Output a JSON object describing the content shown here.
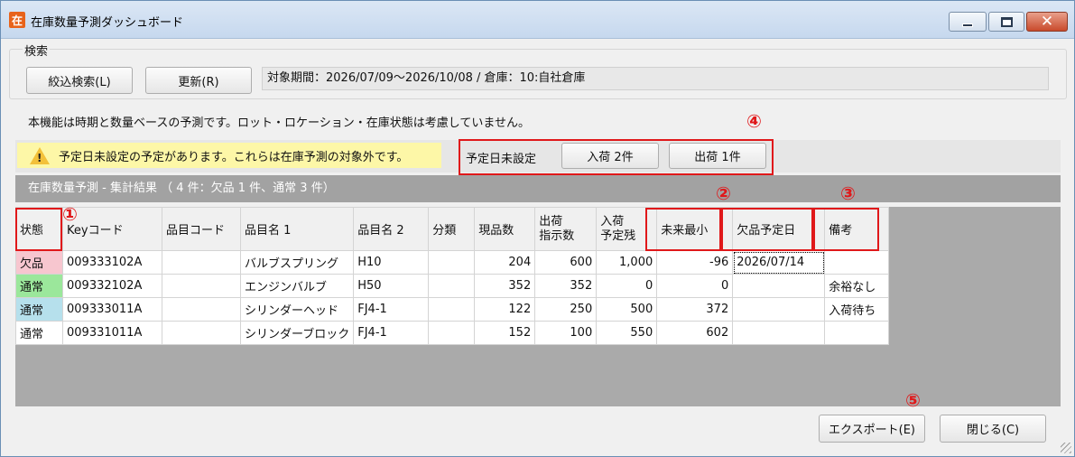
{
  "window": {
    "app_icon": "在",
    "title": "在庫数量予測ダッシュボード"
  },
  "search": {
    "group_label": "検索",
    "filter_button": "絞込検索(L)",
    "refresh_button": "更新(R)",
    "period_text": "対象期間：2026/07/09～2026/10/08 / 倉庫：10:自社倉庫"
  },
  "note": "本機能は時期と数量ベースの予測です。ロット・ロケーション・在庫状態は考慮していません。",
  "warning": {
    "icon": "warning-triangle-icon",
    "message": "予定日未設定の予定があります。これらは在庫予測の対象外です。",
    "unset_label": "予定日未設定",
    "incoming_button": "入荷 2件",
    "outgoing_button": "出荷 1件"
  },
  "summary": "在庫数量予測 - 集計結果 （ 4 件：欠品 1 件、通常 3 件）",
  "table": {
    "headers": [
      "状態",
      "Keyコード",
      "品目コード",
      "品目名 1",
      "品目名 2",
      "分類",
      "現品数",
      "出荷\n指示数",
      "入荷\n予定残",
      "未来最小",
      "欠品予定日",
      "備考"
    ],
    "rows": [
      {
        "status": "欠品",
        "key": "009333102A",
        "item_code": "",
        "name1": "バルブスプリング",
        "name2": "H10",
        "category": "",
        "stock": "204",
        "ship": "600",
        "incoming": "1,000",
        "future_min": "-96",
        "shortage_date": "2026/07/14",
        "remarks": ""
      },
      {
        "status": "通常",
        "key": "009332102A",
        "item_code": "",
        "name1": "エンジンバルブ",
        "name2": "H50",
        "category": "",
        "stock": "352",
        "ship": "352",
        "incoming": "0",
        "future_min": "0",
        "shortage_date": "",
        "remarks": "余裕なし"
      },
      {
        "status": "通常",
        "key": "009333011A",
        "item_code": "",
        "name1": "シリンダーヘッド",
        "name2": "FJ4-1",
        "category": "",
        "stock": "122",
        "ship": "250",
        "incoming": "500",
        "future_min": "372",
        "shortage_date": "",
        "remarks": "入荷待ち"
      },
      {
        "status": "通常",
        "key": "009331011A",
        "item_code": "",
        "name1": "シリンダーブロック",
        "name2": "FJ4-1",
        "category": "",
        "stock": "152",
        "ship": "100",
        "incoming": "550",
        "future_min": "602",
        "shortage_date": "",
        "remarks": ""
      }
    ]
  },
  "annotations": [
    "①",
    "②",
    "③",
    "④",
    "⑤"
  ],
  "footer": {
    "export_button": "エクスポート(E)",
    "close_button": "閉じる(C)"
  },
  "colors": {
    "status_shortage": "#f7c6cf",
    "status_normal_ok": "#9be79b",
    "status_normal_wait": "#b6e0ec",
    "annotation_red": "#e0181a",
    "warning_bg": "#fdf7a7"
  }
}
